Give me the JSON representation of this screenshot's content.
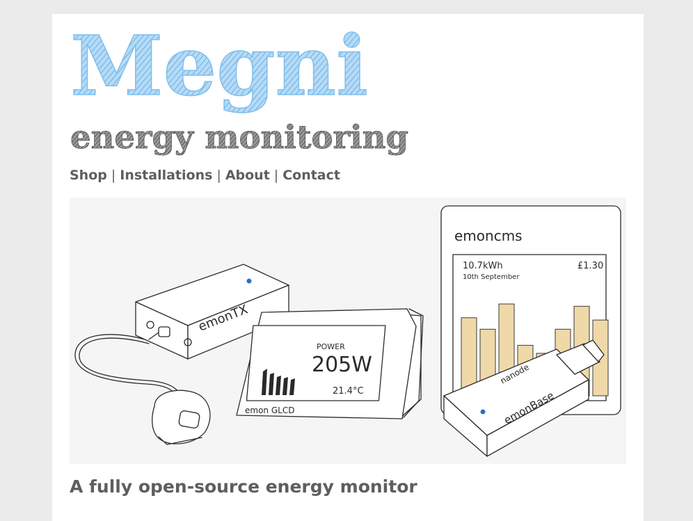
{
  "site": {
    "brand": "Megni",
    "subtitle": "energy monitoring"
  },
  "nav": {
    "items": [
      "Shop",
      "Installations",
      "About",
      "Contact"
    ],
    "separator": "|"
  },
  "hero": {
    "emontx_label": "emonTX",
    "glcd_label": "emon GLCD",
    "glcd_power_label": "POWER",
    "glcd_power_value": "205W",
    "glcd_temp": "21.4°C",
    "emoncms_label": "emoncms",
    "emoncms_energy": "10.7kWh",
    "emoncms_date": "10th September",
    "emoncms_cost": "£1.30",
    "emoncms_bars": [
      0.68,
      0.58,
      0.8,
      0.44,
      0.37,
      0.58,
      0.78,
      0.66
    ],
    "emonbase_label": "emonBase",
    "nanode_label": "nanode"
  },
  "main": {
    "tagline": "A fully open-source energy monitor"
  },
  "colors": {
    "background": "#ebebeb",
    "page": "#ffffff",
    "brand_blue": "#7fbfee",
    "subtitle_gray": "#6a6a6a",
    "text_gray": "#5e5e5e",
    "bar_fill": "#efd9a8",
    "led_blue": "#2d6fc4"
  }
}
